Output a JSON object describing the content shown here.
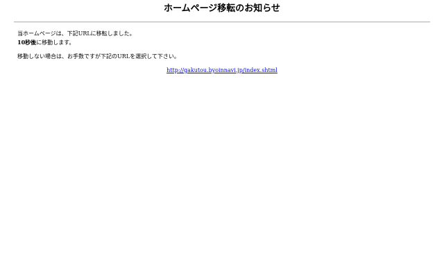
{
  "page": {
    "title": "ホームページ移転のお知らせ",
    "notice": {
      "line1": "当ホームページは、下記URLに移転しました。",
      "line2_bold": "10秒後",
      "line2_rest": "に移動します。"
    },
    "manual": "移動しない場合は、お手数ですが下記のURLを選択して下さい。",
    "link": {
      "text": "http://gakutou.byoinnavi.jp/index.shtml",
      "href": "http://gakutou.byoinnavi.jp/index.shtml"
    },
    "colors": {
      "link": "#0000ee",
      "text": "#000000",
      "background": "#ffffff"
    }
  }
}
